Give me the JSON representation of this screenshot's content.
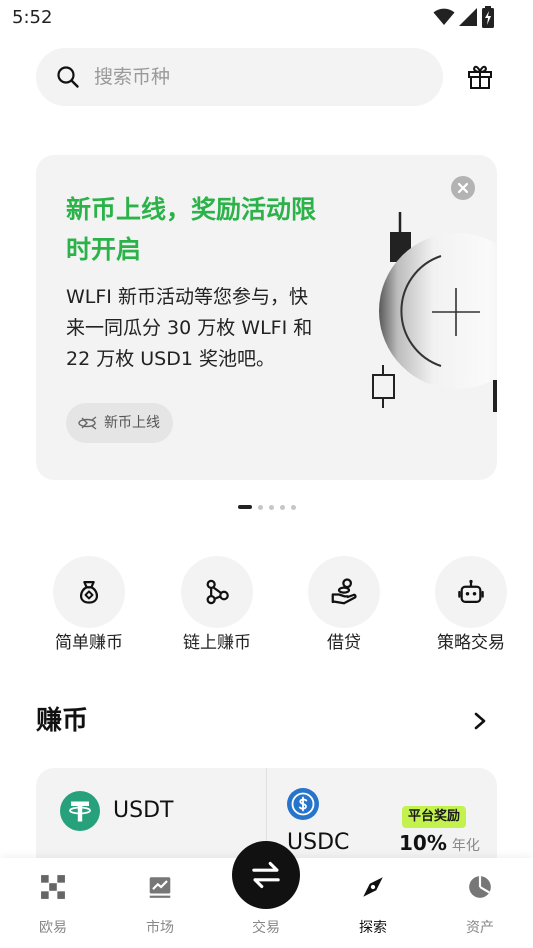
{
  "status_bar": {
    "time": "5:52"
  },
  "search": {
    "placeholder": "搜索币种"
  },
  "banner": {
    "title_lines": [
      "新币上线，奖励活动限",
      "时开启"
    ],
    "body_lines": [
      "WLFI 新币活动等您参与，快",
      "来一同瓜分 30 万枚 WLFI 和",
      "22 万枚 USD1 奖池吧。"
    ],
    "tag": "新币上线"
  },
  "carousel": {
    "page_count": 5,
    "active_index": 0
  },
  "quick_actions": [
    {
      "label": "简单赚币",
      "icon": "money-bag-icon"
    },
    {
      "label": "链上赚币",
      "icon": "nodes-icon"
    },
    {
      "label": "借贷",
      "icon": "hand-coins-icon"
    },
    {
      "label": "策略交易",
      "icon": "robot-icon"
    }
  ],
  "earn": {
    "title": "赚币",
    "cards": [
      {
        "symbol": "USDT",
        "icon": "usdt-logo-icon"
      },
      {
        "symbol": "USDC",
        "icon": "usdc-logo-icon",
        "badge": "平台奖励",
        "apr": "10%",
        "apr_label": "年化"
      }
    ]
  },
  "bottom_nav": [
    {
      "label": "欧易",
      "icon": "okx-logo-icon",
      "active": false
    },
    {
      "label": "市场",
      "icon": "market-chart-icon",
      "active": false
    },
    {
      "label": "交易",
      "icon": "swap-arrows-icon",
      "active": false
    },
    {
      "label": "探索",
      "icon": "compass-icon",
      "active": true
    },
    {
      "label": "资产",
      "icon": "pie-chart-icon",
      "active": false
    }
  ],
  "colors": {
    "accent_green": "#2bb34a",
    "badge_lime": "#c3f24f",
    "usdt": "#26a17b",
    "usdc": "#2775ca",
    "surface": "#f3f3f3"
  }
}
